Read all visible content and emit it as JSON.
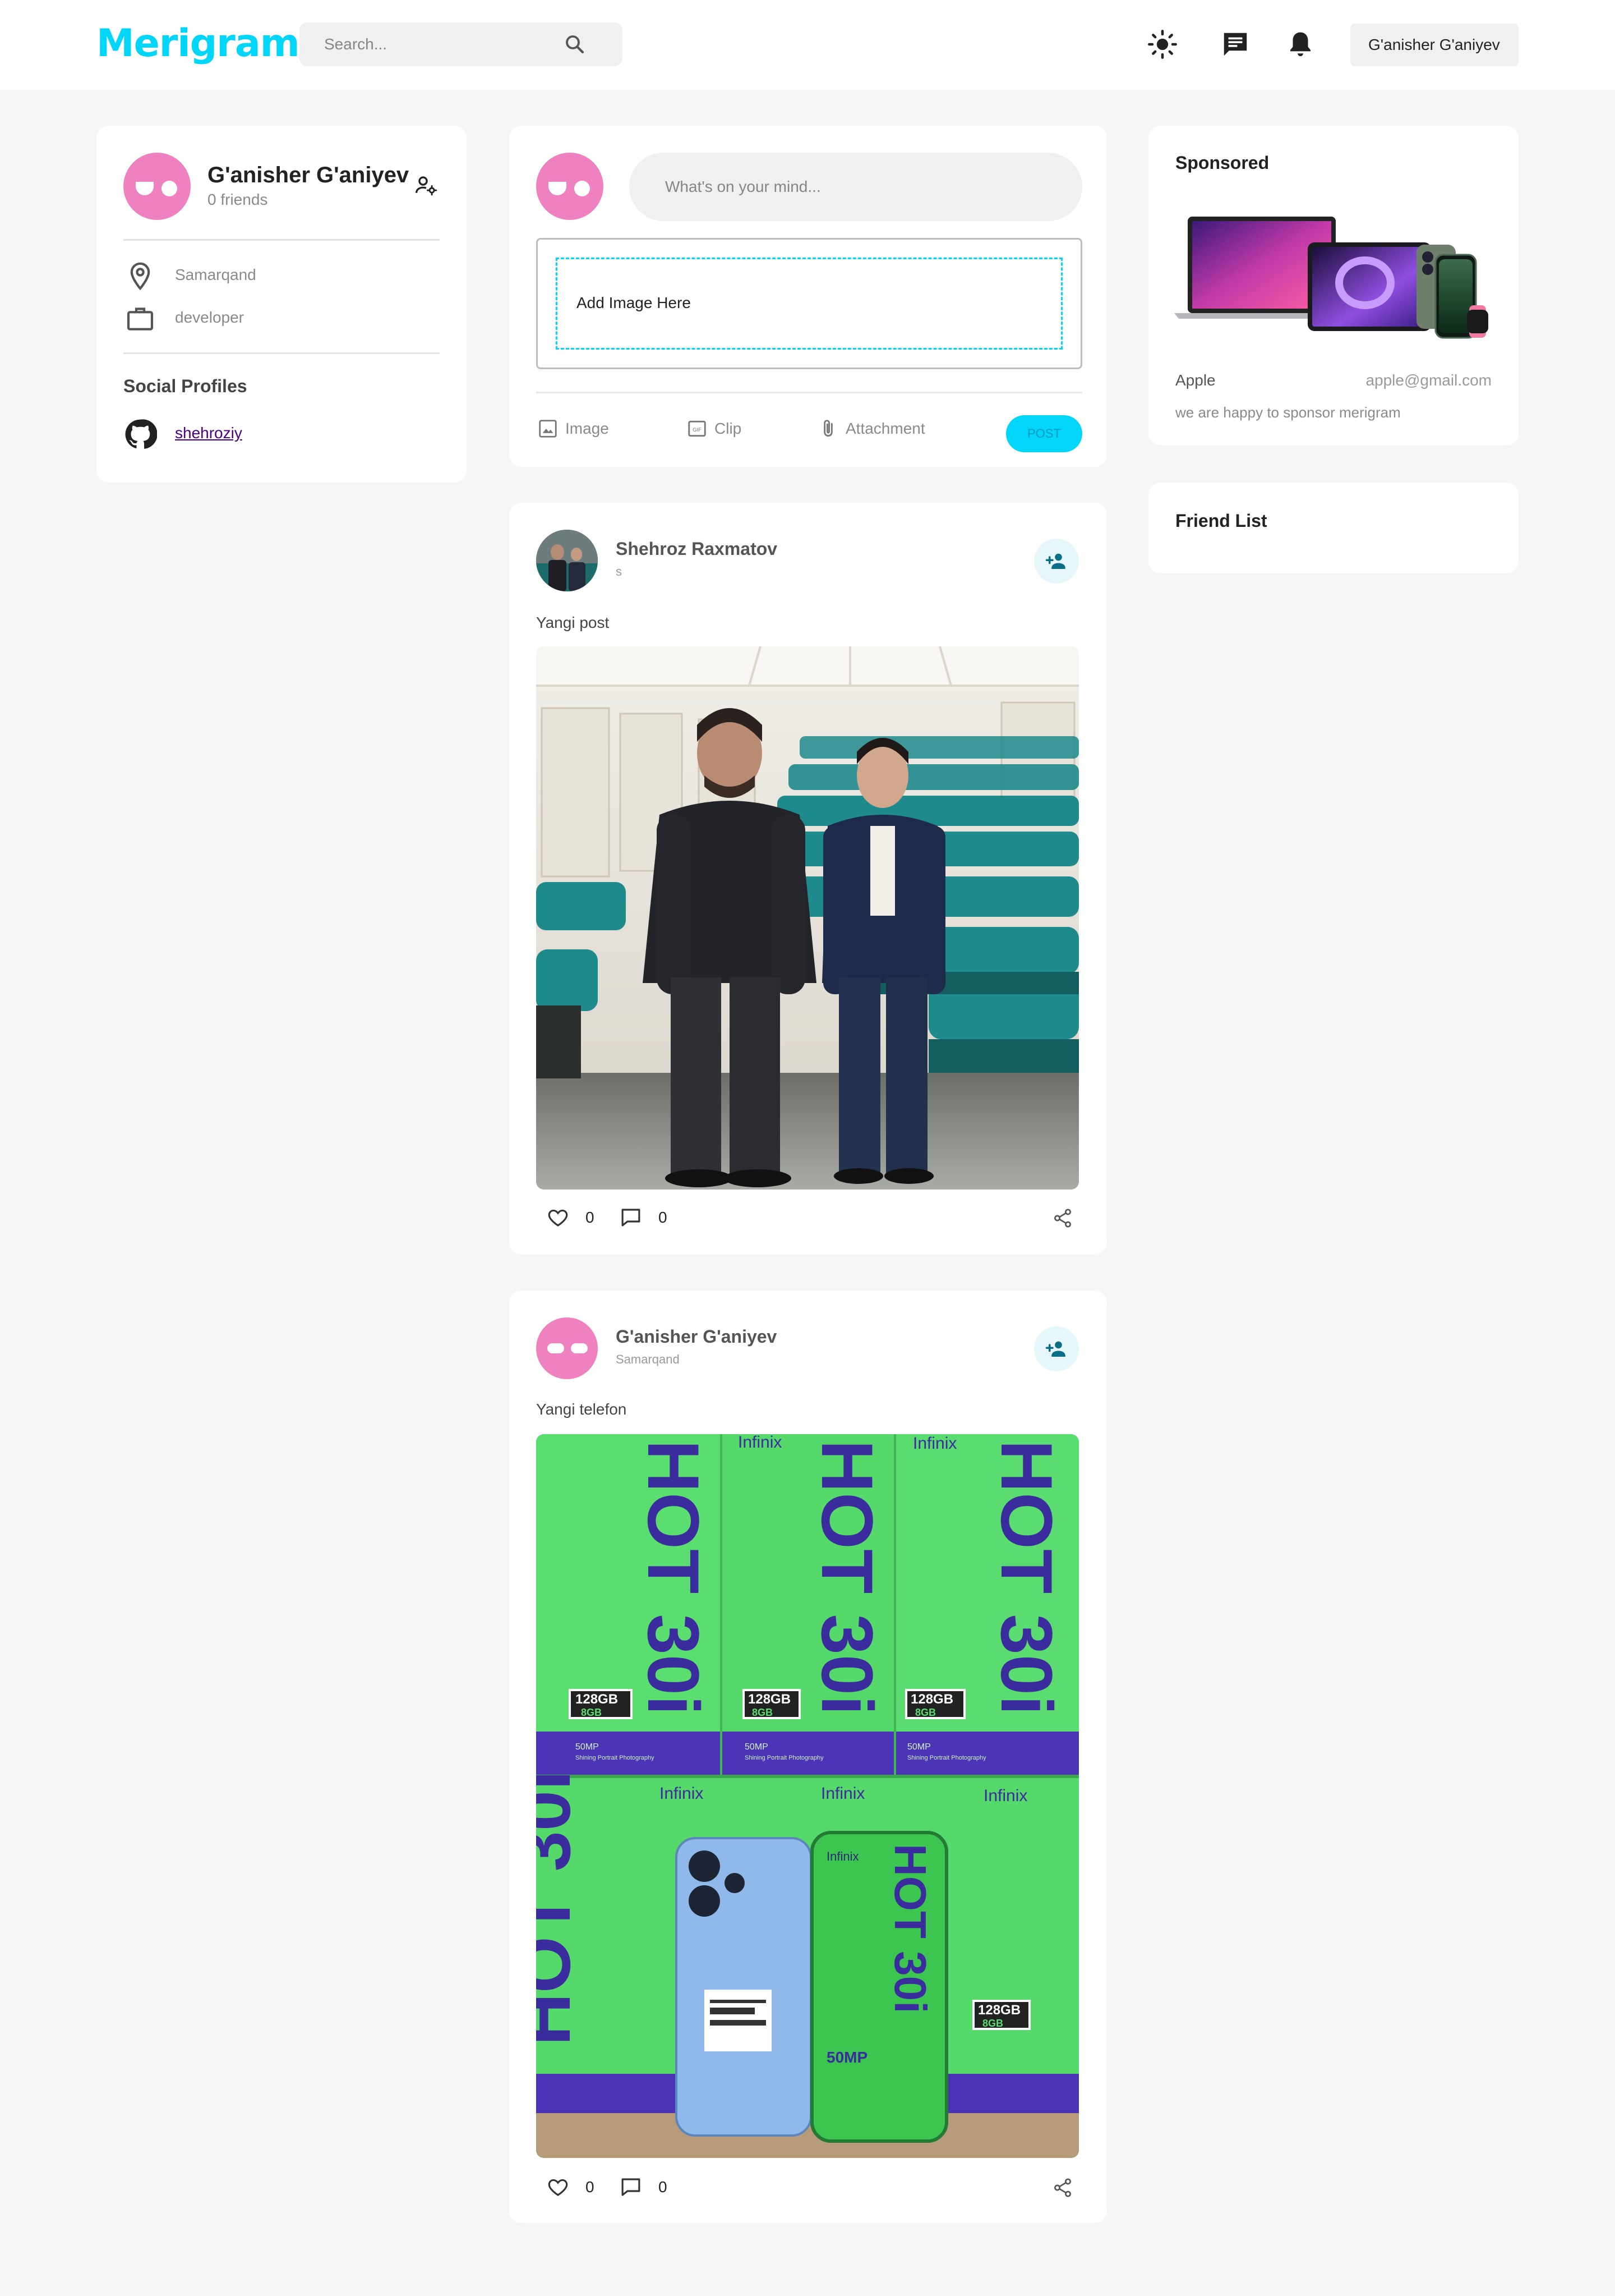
{
  "nav": {
    "logo": "Merigram",
    "search_placeholder": "Search...",
    "user_name": "G'anisher G'aniyev"
  },
  "profile": {
    "name": "G'anisher G'aniyev",
    "friends": "0 friends",
    "location": "Samarqand",
    "occupation": "developer",
    "social_title": "Social Profiles",
    "github_handle": "shehroziy"
  },
  "composer": {
    "placeholder": "What's on your mind...",
    "upload_label": "Add Image Here",
    "actions": {
      "image": "Image",
      "clip": "Clip",
      "attachment": "Attachment"
    },
    "post_label": "POST"
  },
  "posts": [
    {
      "author": "Shehroz Raxmatov",
      "subtitle": "s",
      "text": "Yangi post",
      "likes": "0",
      "comments": "0"
    },
    {
      "author": "G'anisher G'aniyev",
      "subtitle": "Samarqand",
      "text": "Yangi telefon",
      "likes": "0",
      "comments": "0"
    }
  ],
  "sponsored": {
    "title": "Sponsored",
    "name": "Apple",
    "email": "apple@gmail.com",
    "text": "we are happy to sponsor merigram"
  },
  "friend_list": {
    "title": "Friend List"
  },
  "colors": {
    "accent": "#00d5fa",
    "avatar": "#ee82c0",
    "page_bg": "#f6f6f6"
  },
  "photo_box_labels": {
    "brand": "Infinix",
    "model": "HOT 30i",
    "storage": "128GB",
    "ram": "8GB",
    "camera": "50MP",
    "camera_sub": "Shining Portrait Photography"
  }
}
